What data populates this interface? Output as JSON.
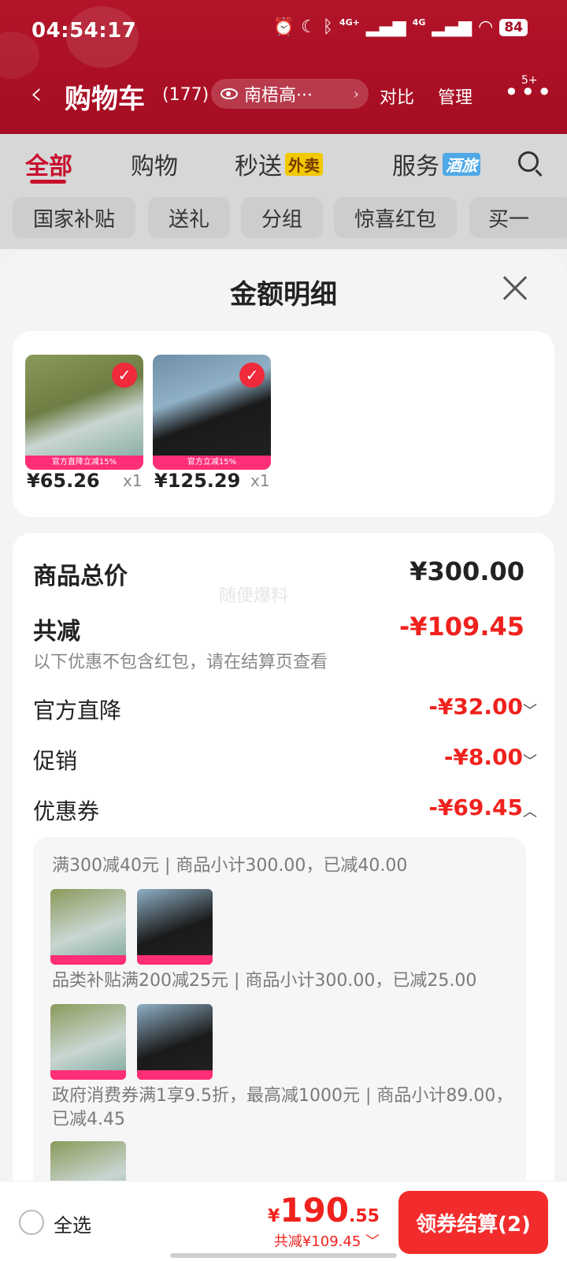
{
  "status": {
    "time": "04:54:17",
    "signal1": "4G+",
    "signal2": "4G",
    "battery": "84"
  },
  "header": {
    "back_glyph": "‹",
    "title": "购物车",
    "count": "(177)",
    "address": "南梧高···",
    "compare": "对比",
    "manage": "管理",
    "more_badge": "5+"
  },
  "tabs": [
    {
      "label": "全部"
    },
    {
      "label": "购物"
    },
    {
      "label": "秒送",
      "tag": "外卖"
    },
    {
      "label": "服务",
      "tag": "酒旅"
    }
  ],
  "chips": [
    "国家补贴",
    "送礼",
    "分组",
    "惊喜红包",
    "买一"
  ],
  "sheet": {
    "title": "金额明细",
    "products": [
      {
        "price": "¥65.26",
        "qty": "x1",
        "band": "官方直降立减15%"
      },
      {
        "price": "¥125.29",
        "qty": "x1",
        "band": "官方立减15%"
      }
    ],
    "watermark": "随便爆料",
    "total_label": "商品总价",
    "total_value": "¥300.00",
    "reduce_label": "共减",
    "reduce_value": "-¥109.45",
    "reduce_note": "以下优惠不包含红包，请在结算页查看",
    "lines": [
      {
        "label": "官方直降",
        "value": "-¥32.00",
        "caret": "﹀"
      },
      {
        "label": "促销",
        "value": "-¥8.00",
        "caret": "﹀"
      },
      {
        "label": "优惠券",
        "value": "-¥69.45",
        "caret": "︿"
      }
    ],
    "coupons": [
      "满300减40元 | 商品小计300.00，已减40.00",
      "品类补贴满200减25元 | 商品小计300.00，已减25.00",
      "政府消费券满1享9.5折，最高减1000元 | 商品小计89.00，已减4.45"
    ]
  },
  "bottom": {
    "select_all": "全选",
    "yen": "¥",
    "total_int": "190",
    "total_dec": ".55",
    "saved": "共减¥109.45 ﹀",
    "checkout": "领券结算(2)"
  }
}
